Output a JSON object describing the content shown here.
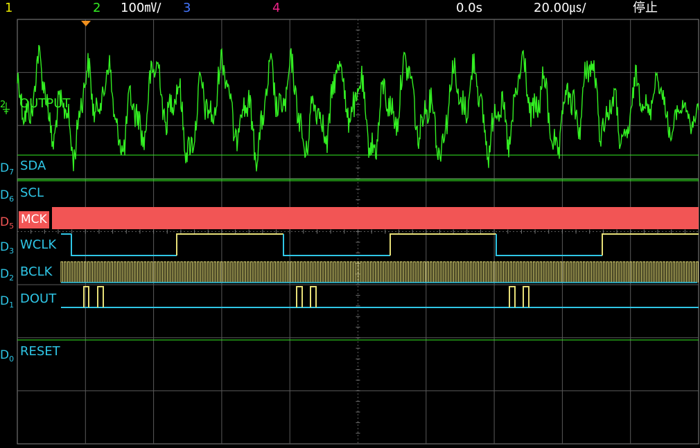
{
  "status_bar": {
    "ch1_label": "1",
    "ch2_label": "2",
    "ch2_scale": "100㎷/",
    "ch3_label": "3",
    "ch4_label": "4",
    "time_offset": "0.0s",
    "timebase": "20.00㎲/",
    "run_state": "停止"
  },
  "analog_channel": {
    "marker": "2",
    "label": "OUTPUT"
  },
  "digital_channels": [
    {
      "tag": "D",
      "index": "7",
      "label": "SDA"
    },
    {
      "tag": "D",
      "index": "6",
      "label": "SCL"
    },
    {
      "tag": "D",
      "index": "5",
      "label": "MCK"
    },
    {
      "tag": "D",
      "index": "3",
      "label": "WCLK"
    },
    {
      "tag": "D",
      "index": "2",
      "label": "BCLK"
    },
    {
      "tag": "D",
      "index": "1",
      "label": "DOUT"
    },
    {
      "tag": "D",
      "index": "0",
      "label": "RESET"
    }
  ],
  "colors": {
    "ch1": "#e6e600",
    "ch2": "#33ee22",
    "ch3": "#4477ff",
    "ch4": "#ee2288",
    "digital": "#2fc6e6",
    "digital_high": "#e8e078",
    "mck_band": "#f25555",
    "grid": "#5a5a5a",
    "trigger_marker": "#f0901e"
  }
}
